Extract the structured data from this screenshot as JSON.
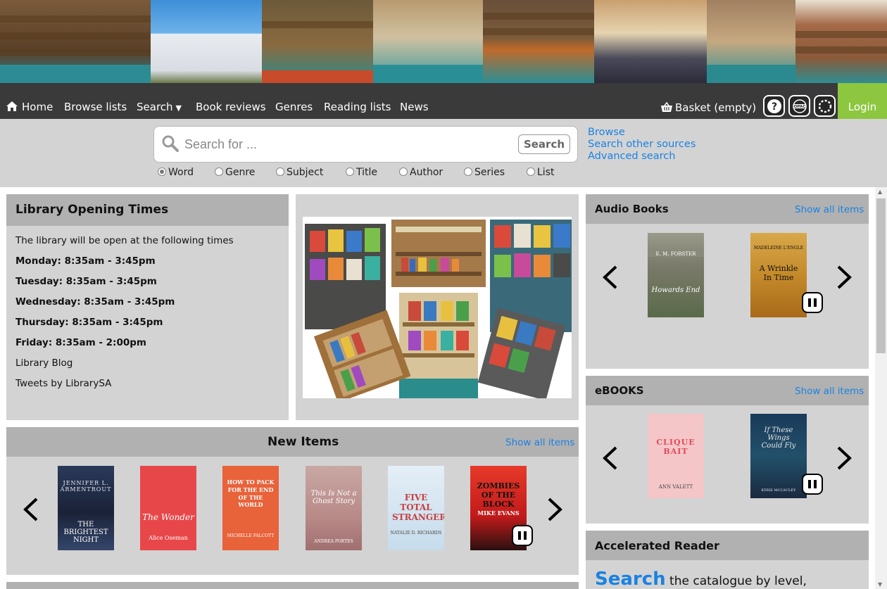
{
  "nav": {
    "home": "Home",
    "browse_lists": "Browse lists",
    "search": "Search",
    "book_reviews": "Book reviews",
    "genres": "Genres",
    "reading_lists": "Reading lists",
    "news": "News",
    "basket": "Basket (empty)",
    "login": "Login",
    "icons": [
      "help-icon",
      "opac-icon",
      "loading-icon"
    ]
  },
  "search": {
    "placeholder": "Search for ...",
    "button": "Search",
    "options": [
      "Word",
      "Genre",
      "Subject",
      "Title",
      "Author",
      "Series",
      "List"
    ],
    "selected": "Word",
    "links": [
      "Browse",
      "Search other sources",
      "Advanced search"
    ]
  },
  "opening_times": {
    "title": "Library Opening Times",
    "intro": "The library will be open at the following times",
    "hours": [
      "Monday: 8:35am - 3:45pm",
      "Tuesday: 8:35am - 3:45pm",
      "Wednesday: 8:35am - 3:45pm",
      "Thursday: 8:35am - 3:45pm",
      "Friday: 8:35am - 2:00pm"
    ],
    "blog_link": "Library Blog",
    "tweets_link": "Tweets by LibrarySA"
  },
  "new_items": {
    "title": "New Items",
    "show_all": "Show all items",
    "covers": [
      {
        "title": "THE BRIGHTEST NIGHT",
        "author": "JENNIFER L. ARMENTROUT"
      },
      {
        "title": "The Wonder",
        "author": "Alice Oseman"
      },
      {
        "title": "HOW TO PACK FOR THE END OF THE WORLD",
        "author": "MICHELLE FALCOTT"
      },
      {
        "title": "This Is Not a Ghost Story",
        "author": "ANDREA PORTES"
      },
      {
        "title": "FIVE TOTAL STRANGERS",
        "author": "NATALIE D. RICHARDS"
      },
      {
        "title": "ZOMBIES OF THE BLOCK",
        "author": "MIKE EVANS"
      }
    ]
  },
  "audio_books": {
    "title": "Audio Books",
    "show_all": "Show all items",
    "covers": [
      {
        "title": "Howards End",
        "author": "E. M. FORSTER"
      },
      {
        "title": "A Wrinkle In Time",
        "author": "MADELEINE L'ENGLE"
      }
    ]
  },
  "ebooks": {
    "title": "eBOOKS",
    "show_all": "Show all items",
    "covers": [
      {
        "title": "CLIQUE BAIT",
        "author": "ANN VALETT"
      },
      {
        "title": "If These Wings Could Fly",
        "author": "KYRIE MCCAULEY"
      }
    ]
  },
  "accelerated_reader": {
    "title": "Accelerated Reader",
    "search_word": "Search",
    "text": " the catalogue by level,"
  },
  "colors": {
    "nav_bg": "#3a3a3a",
    "login_bg": "#8dc63f",
    "link": "#1a82e2",
    "panel_bg": "#d3d3d3",
    "panel_head": "#b1b1b1"
  }
}
